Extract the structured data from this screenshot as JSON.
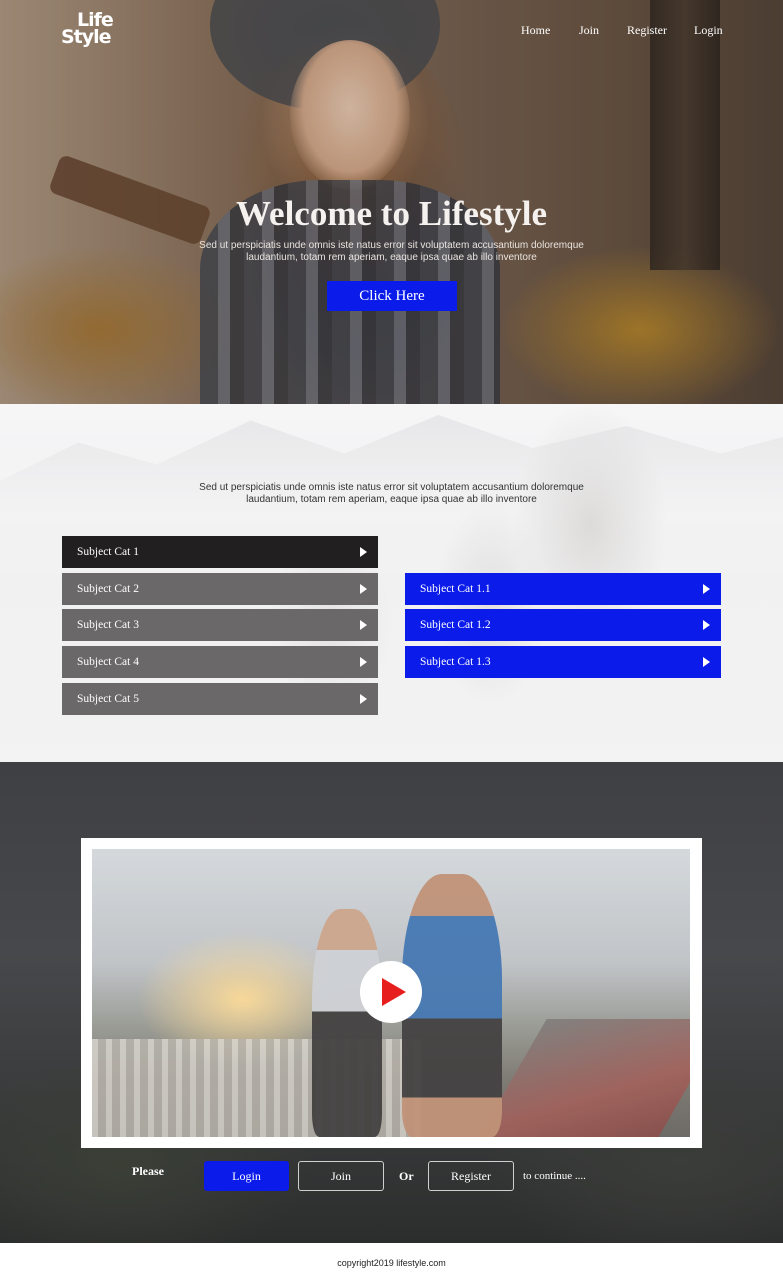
{
  "brand": {
    "logo_line1": "Life",
    "logo_line2": "Style"
  },
  "nav": {
    "home": "Home",
    "join": "Join",
    "register": "Register",
    "login": "Login"
  },
  "hero": {
    "title": "Welcome to Lifestyle",
    "text": "Sed ut perspiciatis unde omnis iste natus error sit voluptatem accusantium doloremque laudantium, totam rem aperiam, eaque ipsa quae ab illo inventore",
    "button": "Click Here"
  },
  "categories": {
    "text": "Sed ut perspiciatis unde omnis iste natus error sit voluptatem accusantium doloremque laudantium, totam rem aperiam, eaque ipsa quae ab illo inventore",
    "left": [
      {
        "label": "Subject Cat  1",
        "active": true
      },
      {
        "label": "Subject Cat  2",
        "active": false
      },
      {
        "label": "Subject Cat  3",
        "active": false
      },
      {
        "label": "Subject Cat  4",
        "active": false
      },
      {
        "label": "Subject Cat  5",
        "active": false
      }
    ],
    "right": [
      {
        "label": "Subject Cat  1.1"
      },
      {
        "label": "Subject Cat  1.2"
      },
      {
        "label": "Subject Cat  1.3"
      }
    ]
  },
  "cta": {
    "please": "Please",
    "login": "Login",
    "join": "Join",
    "or": "Or",
    "register": "Register",
    "continue": "to continue ...."
  },
  "footer": {
    "copyright": "copyright2019 lifestyle.com"
  },
  "colors": {
    "accent": "#0a1bea",
    "active_item": "#211f1f",
    "inactive_item": "#6a6868",
    "play": "#e61e1e"
  },
  "icons": {
    "play": "play-icon",
    "arrow": "caret-right-icon"
  }
}
